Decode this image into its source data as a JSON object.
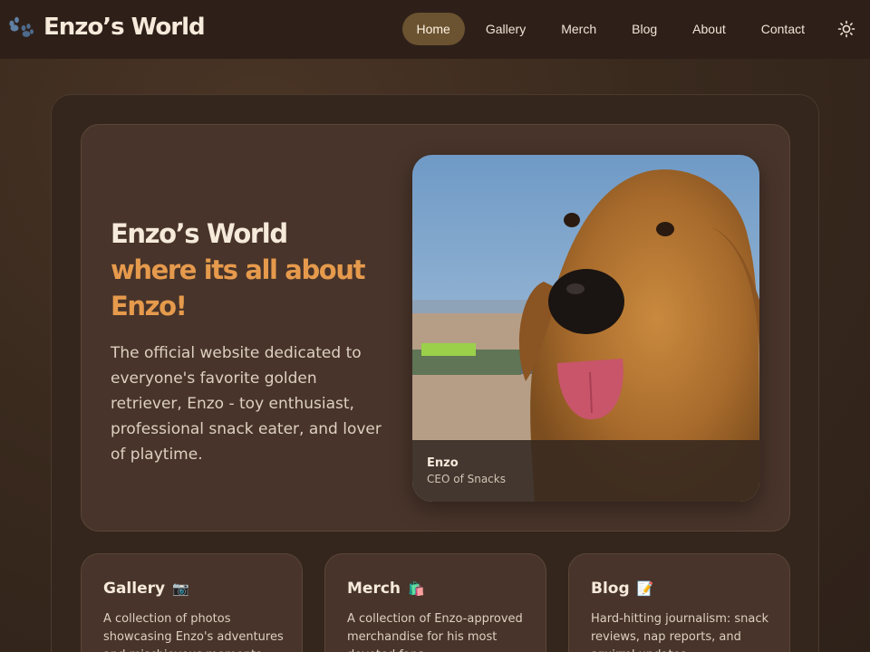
{
  "nav": {
    "brand": "Enzo’s World",
    "brand_icon": "paw-icon",
    "links": [
      {
        "label": "Home",
        "active": true
      },
      {
        "label": "Gallery",
        "active": false
      },
      {
        "label": "Merch",
        "active": false
      },
      {
        "label": "Blog",
        "active": false
      },
      {
        "label": "About",
        "active": false
      },
      {
        "label": "Contact",
        "active": false
      }
    ],
    "theme_icon": "sun-icon"
  },
  "hero": {
    "title_line1": "Enzo’s World",
    "title_line2": "where its all about Enzo!",
    "description": "The official website dedicated to everyone's favorite golden retriever, Enzo - toy enthusiast, professional snack eater, and lover of playtime.",
    "photo": {
      "icon": "golden-retriever-photo",
      "caption_name": "Enzo",
      "caption_role": "CEO of Snacks"
    }
  },
  "cards": [
    {
      "title": "Gallery",
      "emoji": "📷",
      "description": "A collection of photos showcasing Enzo's adventures and mischievous moments."
    },
    {
      "title": "Merch",
      "emoji": "🛍️",
      "description": "A collection of Enzo-approved merchandise for his most devoted fans."
    },
    {
      "title": "Blog",
      "emoji": "📝",
      "description": "Hard-hitting journalism: snack reviews, nap reports, and squirrel updates."
    }
  ],
  "colors": {
    "accent": "#e69a4c",
    "nav_active": "#6b5230",
    "panel": "#48342a",
    "background": "#3a2a1e"
  }
}
